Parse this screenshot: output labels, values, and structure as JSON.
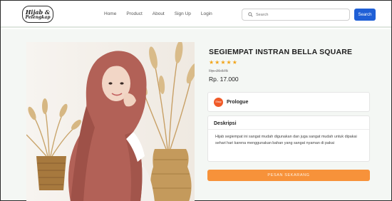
{
  "header": {
    "logo": {
      "line1": "Hijab &",
      "line2": "Pelengkap"
    },
    "nav": [
      "Home",
      "Product",
      "About",
      "Sign Up",
      "Login"
    ],
    "search": {
      "placeholder": "Search",
      "button_label": "Search",
      "icon": "search-icon"
    }
  },
  "product": {
    "title": "SEGIEMPAT INSTRAN BELLA SQUARE",
    "rating_stars": "★★★★★",
    "rating": 5,
    "old_price": "Rp. 20.575",
    "price": "Rp. 17.000",
    "store": {
      "avatar_text": "Shop",
      "name": "Prologue"
    },
    "description_title": "Deskripsi",
    "description": "Hijab segiempat ini sangat mudah digunakan dan juga sangat mudah untuk dipakai sehari hari karena menggunakan bahan yang sangat nyaman di pakai",
    "order_button": "PESAN SEKARANG"
  },
  "colors": {
    "primary_blue": "#1f5fd6",
    "order_orange": "#f7923a",
    "star_color": "#f2a51a",
    "store_avatar": "#f05a28",
    "hijab_color": "#b26157"
  }
}
